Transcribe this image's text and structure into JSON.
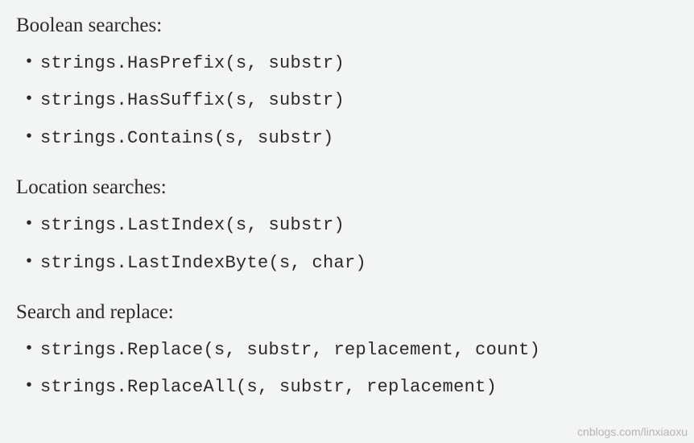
{
  "sections": [
    {
      "heading": "Boolean searches:",
      "items": [
        "strings.HasPrefix(s, substr)",
        "strings.HasSuffix(s, substr)",
        "strings.Contains(s, substr)"
      ]
    },
    {
      "heading": "Location searches:",
      "items": [
        "strings.LastIndex(s, substr)",
        "strings.LastIndexByte(s, char)"
      ]
    },
    {
      "heading": "Search and replace:",
      "items": [
        "strings.Replace(s, substr, replacement, count)",
        "strings.ReplaceAll(s, substr, replacement)"
      ]
    }
  ],
  "watermark_left": "",
  "watermark_right": "cnblogs.com/linxiaoxu"
}
